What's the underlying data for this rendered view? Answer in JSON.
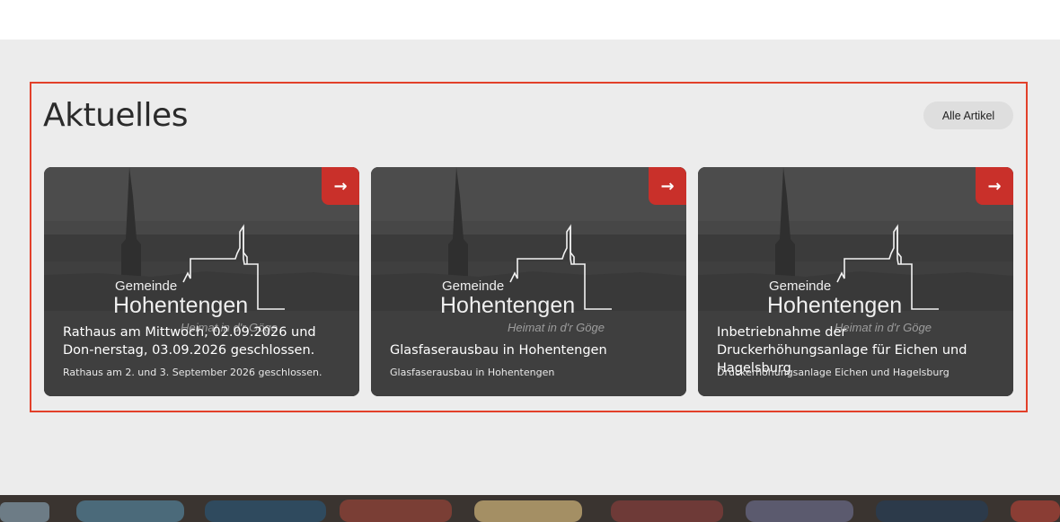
{
  "section": {
    "title": "Aktuelles",
    "all_button_label": "Alle Artikel"
  },
  "cards": [
    {
      "title": "Rathaus am Mittwoch, 02.09.2026 und Don-nerstag, 03.09.2026 geschlossen.",
      "subtitle": "Rathaus am 2. und 3. September 2026 geschlossen.",
      "arrow": "→"
    },
    {
      "title": "Glasfaserausbau in Hohentengen",
      "subtitle": "Glasfaserausbau in Hohentengen",
      "arrow": "→"
    },
    {
      "title": "Inbetriebnahme der Druckerhöhungsanlage für Eichen und Hagelsburg",
      "subtitle": "Druckerhöhungsanlage Eichen und Hagelsburg",
      "arrow": "→"
    }
  ],
  "logo": {
    "line1": "Gemeinde",
    "line2": "Hohentengen",
    "tagline": "Heimat in d'r Göge"
  },
  "colors": {
    "accent": "#c9302a",
    "frame": "#e2402a",
    "background": "#ececec"
  }
}
